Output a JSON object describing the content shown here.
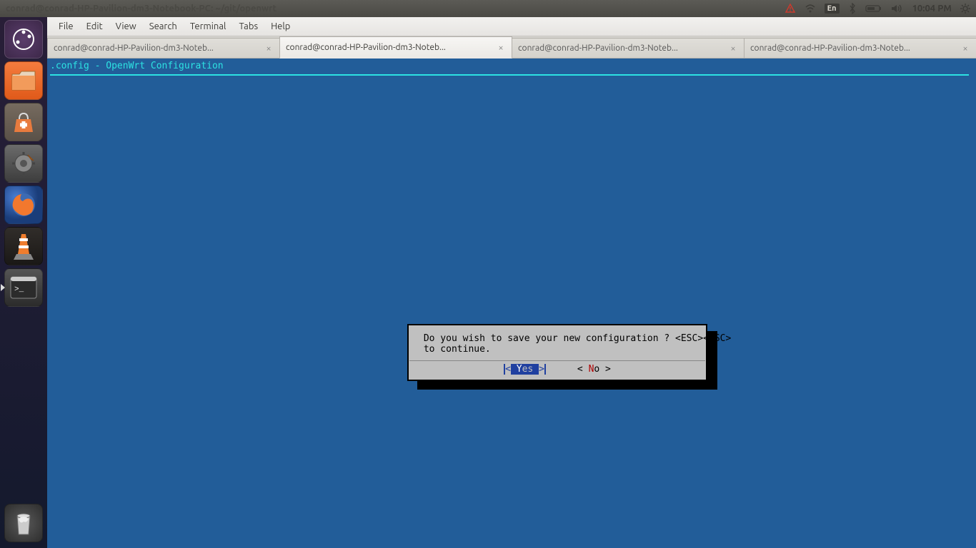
{
  "top_panel": {
    "window_title": "conrad@conrad-HP-Pavilion-dm3-Notebook-PC: ~/git/openwrt",
    "lang_indicator": "En",
    "clock": "10:04 PM"
  },
  "launcher": {
    "items": [
      "dash",
      "files",
      "software",
      "settings",
      "firefox",
      "vlc",
      "terminal"
    ],
    "trash": "trash"
  },
  "menubar": {
    "items": [
      "File",
      "Edit",
      "View",
      "Search",
      "Terminal",
      "Tabs",
      "Help"
    ]
  },
  "tabs": [
    {
      "label": "conrad@conrad-HP-Pavilion-dm3-Noteb...",
      "active": false
    },
    {
      "label": "conrad@conrad-HP-Pavilion-dm3-Noteb...",
      "active": true
    },
    {
      "label": "conrad@conrad-HP-Pavilion-dm3-Noteb...",
      "active": false
    },
    {
      "label": "conrad@conrad-HP-Pavilion-dm3-Noteb...",
      "active": false
    }
  ],
  "terminal": {
    "config_title": ".config - OpenWrt Configuration"
  },
  "dialog": {
    "line1": " Do you wish to save your new configuration ? <ESC><ESC>",
    "line2": " to continue.",
    "yes_hot": "Y",
    "yes_rest": "es",
    "no_hot": "N",
    "no_rest": "o"
  }
}
